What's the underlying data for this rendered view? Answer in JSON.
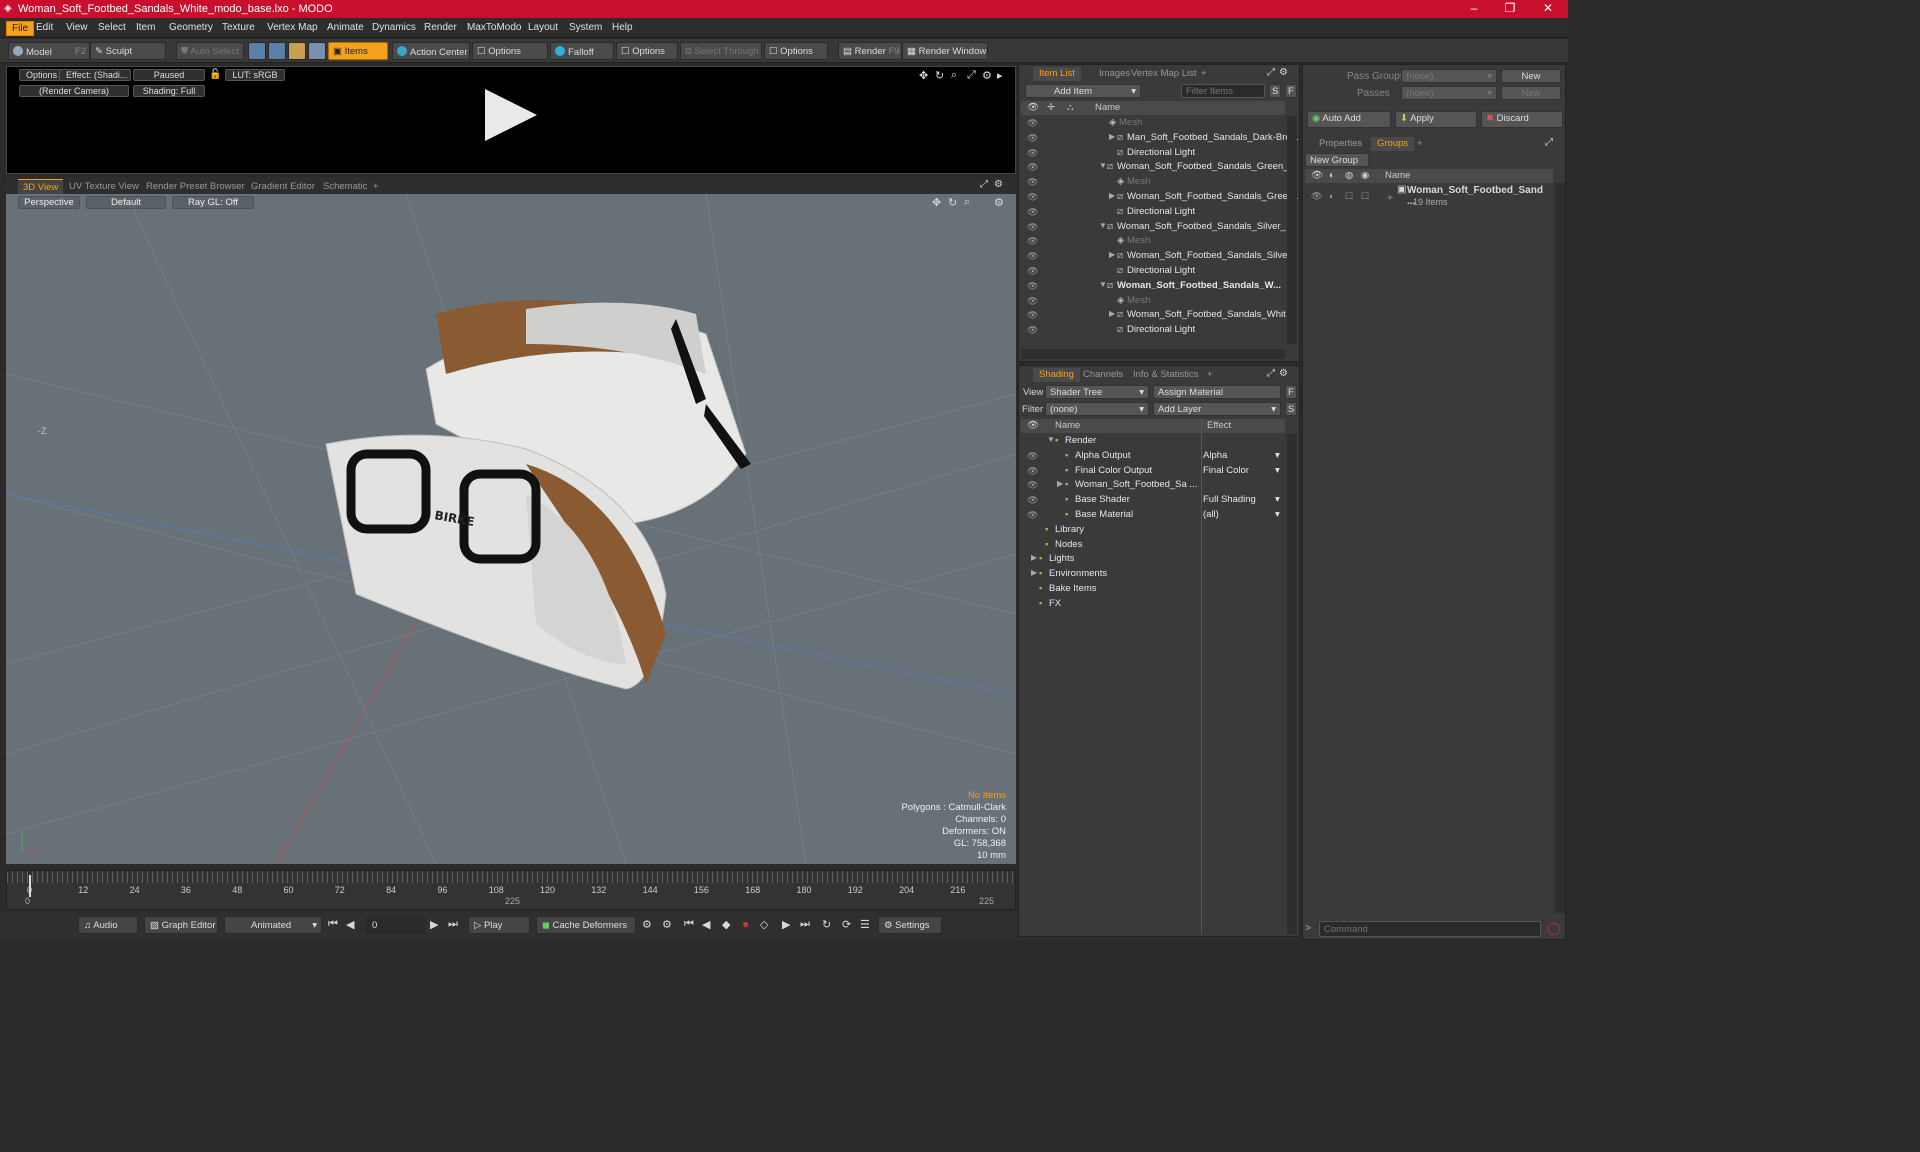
{
  "window": {
    "title": "Woman_Soft_Footbed_Sandals_White_modo_base.lxo - MODO",
    "minimize": "–",
    "maximize": "❐",
    "close": "✕"
  },
  "menu": [
    "File",
    "Edit",
    "View",
    "Select",
    "Item",
    "Geometry",
    "Texture",
    "Vertex Map",
    "Animate",
    "Dynamics",
    "Render",
    "MaxToModo",
    "Layout",
    "System",
    "Help"
  ],
  "toolbar": {
    "model": "Model",
    "model_key": "F2",
    "sculpt": "Sculpt",
    "auto_select": "Auto Select",
    "items": "Items",
    "action_center": "Action Center",
    "options1": "Options",
    "falloff": "Falloff",
    "options2": "Options",
    "select_through": "Select Through",
    "options3": "Options",
    "render": "Render",
    "render_key": "F9",
    "render_window": "Render Window"
  },
  "preview": {
    "options": "Options",
    "effect": "Effect: (Shadi...",
    "paused": "Paused",
    "lut": "LUT: sRGB",
    "camera": "(Render Camera)",
    "shading": "Shading: Full"
  },
  "view_tabs": [
    "3D View",
    "UV Texture View",
    "Render Preset Browser",
    "Gradient Editor",
    "Schematic",
    "+"
  ],
  "viewport": {
    "perspective": "Perspective",
    "default": "Default",
    "raygl": "Ray GL: Off",
    "axis_label": "-Z",
    "stats": {
      "no_items": "No Items",
      "polygons": "Polygons : Catmull-Clark",
      "channels": "Channels: 0",
      "deformers": "Deformers: ON",
      "gl": "GL: 758,368",
      "scale": "10 mm"
    }
  },
  "timeline": {
    "ticks": [
      "0",
      "12",
      "24",
      "36",
      "48",
      "60",
      "72",
      "84",
      "96",
      "108",
      "120",
      "132",
      "144",
      "156",
      "168",
      "180",
      "192",
      "204",
      "216"
    ],
    "start": "0",
    "mid": "225",
    "end": "225"
  },
  "bottom": {
    "audio": "Audio",
    "graph_editor": "Graph Editor",
    "animated": "Animated",
    "frame": "0",
    "play": "Play",
    "cache": "Cache Deformers",
    "settings": "Settings"
  },
  "item_list": {
    "tabs": [
      "Item List",
      "Images",
      "Vertex Map List",
      "+"
    ],
    "add_item": "Add Item",
    "filter_placeholder": "Filter Items",
    "s": "S",
    "f": "F",
    "col_name": "Name",
    "rows": [
      {
        "label": "Mesh",
        "indent": 96,
        "dim": true,
        "bold": false,
        "arrow": ""
      },
      {
        "label": "Man_Soft_Footbed_Sandals_Dark-Bro...",
        "indent": 104,
        "dim": false,
        "bold": false,
        "arrow": "▶"
      },
      {
        "label": "Directional Light",
        "indent": 104,
        "dim": false,
        "bold": false,
        "arrow": ""
      },
      {
        "label": "Woman_Soft_Footbed_Sandals_Green_...",
        "indent": 94,
        "dim": false,
        "bold": false,
        "arrow": "▼"
      },
      {
        "label": "Mesh",
        "indent": 104,
        "dim": true,
        "bold": false,
        "arrow": ""
      },
      {
        "label": "Woman_Soft_Footbed_Sandals_Gree ...",
        "indent": 104,
        "dim": false,
        "bold": false,
        "arrow": "▶"
      },
      {
        "label": "Directional Light",
        "indent": 104,
        "dim": false,
        "bold": false,
        "arrow": ""
      },
      {
        "label": "Woman_Soft_Footbed_Sandals_Silver_ ...",
        "indent": 94,
        "dim": false,
        "bold": false,
        "arrow": "▼"
      },
      {
        "label": "Mesh",
        "indent": 104,
        "dim": true,
        "bold": false,
        "arrow": ""
      },
      {
        "label": "Woman_Soft_Footbed_Sandals_Silver...",
        "indent": 104,
        "dim": false,
        "bold": false,
        "arrow": "▶"
      },
      {
        "label": "Directional Light",
        "indent": 104,
        "dim": false,
        "bold": false,
        "arrow": ""
      },
      {
        "label": "Woman_Soft_Footbed_Sandals_W...",
        "indent": 94,
        "dim": false,
        "bold": true,
        "arrow": "▼"
      },
      {
        "label": "Mesh",
        "indent": 104,
        "dim": true,
        "bold": false,
        "arrow": ""
      },
      {
        "label": "Woman_Soft_Footbed_Sandals_Whit ...",
        "indent": 104,
        "dim": false,
        "bold": false,
        "arrow": "▶"
      },
      {
        "label": "Directional Light",
        "indent": 104,
        "dim": false,
        "bold": false,
        "arrow": ""
      }
    ]
  },
  "shading": {
    "tabs": [
      "Shading",
      "Channels",
      "Info & Statistics",
      "+"
    ],
    "view_label": "View",
    "view_value": "Shader Tree",
    "assign_material": "Assign Material",
    "f": "F",
    "filter_label": "Filter",
    "filter_value": "(none)",
    "add_layer": "Add Layer",
    "s": "S",
    "col_name": "Name",
    "col_effect": "Effect",
    "rows": [
      {
        "label": "Render",
        "effect": "",
        "indent": 44,
        "eye": false,
        "arrow": "▼"
      },
      {
        "label": "Alpha Output",
        "effect": "Alpha",
        "indent": 54,
        "eye": true,
        "arrow": ""
      },
      {
        "label": "Final Color Output",
        "effect": "Final Color",
        "indent": 54,
        "eye": true,
        "arrow": ""
      },
      {
        "label": "Woman_Soft_Footbed_Sa ...",
        "effect": "",
        "indent": 54,
        "eye": true,
        "arrow": "▶"
      },
      {
        "label": "Base Shader",
        "effect": "Full Shading",
        "indent": 54,
        "eye": true,
        "arrow": ""
      },
      {
        "label": "Base Material",
        "effect": "(all)",
        "indent": 54,
        "eye": true,
        "arrow": ""
      },
      {
        "label": "Library",
        "effect": "",
        "indent": 34,
        "eye": false,
        "arrow": ""
      },
      {
        "label": "Nodes",
        "effect": "",
        "indent": 34,
        "eye": false,
        "arrow": ""
      },
      {
        "label": "Lights",
        "effect": "",
        "indent": 28,
        "eye": false,
        "arrow": "▶"
      },
      {
        "label": "Environments",
        "effect": "",
        "indent": 28,
        "eye": false,
        "arrow": "▶"
      },
      {
        "label": "Bake Items",
        "effect": "",
        "indent": 28,
        "eye": false,
        "arrow": ""
      },
      {
        "label": "FX",
        "effect": "",
        "indent": 28,
        "eye": false,
        "arrow": ""
      }
    ]
  },
  "right": {
    "pass_groups": "Pass Groups",
    "pass_groups_value": "(none)",
    "new": "New",
    "passes": "Passes",
    "passes_value": "(none)",
    "new2": "New",
    "auto_add": "Auto Add",
    "apply": "Apply",
    "discard": "Discard",
    "tabs": [
      "Properties",
      "Groups",
      "+"
    ],
    "new_group": "New Group",
    "col_name": "Name",
    "group_name": "Woman_Soft_Footbed_Sand ...",
    "group_count": "19 Items",
    "command_placeholder": "Command"
  }
}
